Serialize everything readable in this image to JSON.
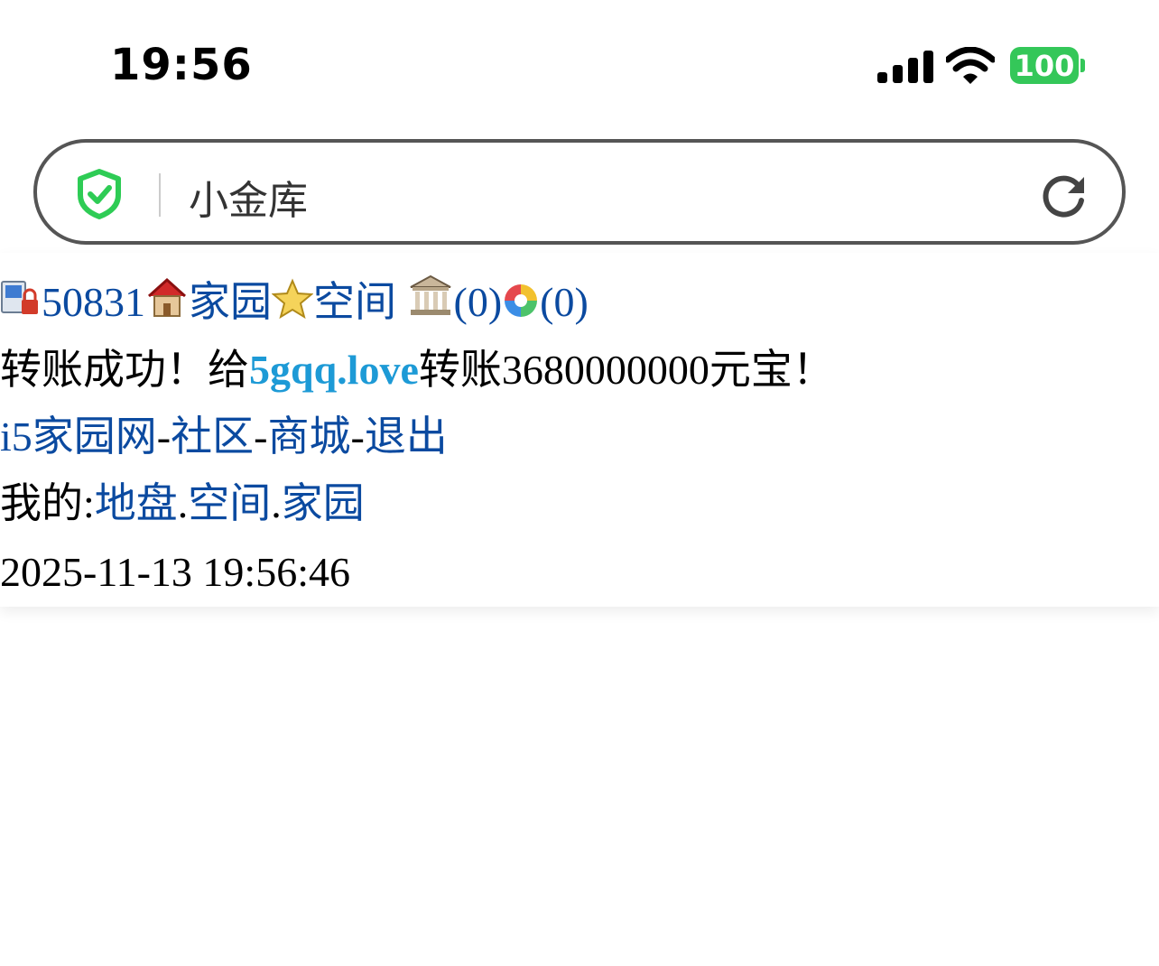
{
  "status_bar": {
    "time": "19:56",
    "battery": "100",
    "colors": {
      "battery": "#34c759"
    }
  },
  "address_bar": {
    "title": "小金库"
  },
  "nav_line": {
    "user_id": "50831",
    "home_link": "家园",
    "space_link": "空间",
    "bank_count": "(0)",
    "album_count": "(0)"
  },
  "message": {
    "prefix": "转账成功！给",
    "recipient": "5gqq.love",
    "suffix": "转账3680000000元宝！"
  },
  "links": {
    "site": "i5家园网",
    "sep1": "-",
    "community": "社区",
    "sep2": "-",
    "mall": "商城",
    "sep3": "-",
    "logout": "退出"
  },
  "mine": {
    "label": "我的:",
    "land": "地盘",
    "dot1": ".",
    "space": "空间",
    "dot2": ".",
    "home": "家园"
  },
  "timestamp": "2025-11-13 19:56:46",
  "colors": {
    "link": "#0b4aa0",
    "highlight_link": "#1d9ad6",
    "shield": "#2ecc55"
  }
}
